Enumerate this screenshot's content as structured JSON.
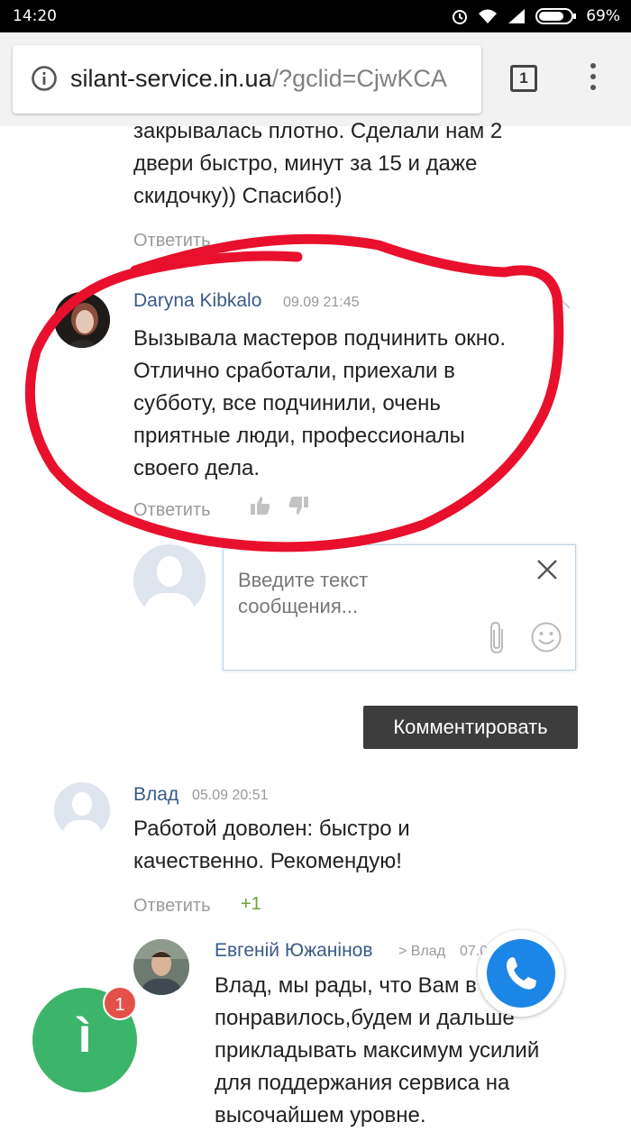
{
  "status": {
    "time": "14:20",
    "battery": "69%"
  },
  "browser": {
    "url_main": "silant-service.in.ua",
    "url_rest": "/?gclid=CjwKCA",
    "tab_count": "1"
  },
  "prev_comment": {
    "lines": [
      "закрывалась плотно. Сделали нам 2",
      "двери быстро, минут за 15 и даже",
      "скидочку)) Спасибо!)"
    ],
    "reply": "Ответить"
  },
  "comment1": {
    "author": "Daryna Kibkalo",
    "date": "09.09 21:45",
    "lines": [
      "Вызывала мастеров подчинить окно.",
      "Отлично сработали, приехали в",
      "субботу, все подчинили, очень",
      "приятные люди, профессионалы",
      "своего дела."
    ],
    "reply": "Ответить"
  },
  "reply_form": {
    "placeholder_line1": "Введите текст",
    "placeholder_line2": "сообщения...",
    "submit": "Комментировать"
  },
  "comment2": {
    "author": "Влад",
    "date": "05.09 20:51",
    "lines": [
      "Работой доволен: быстро и",
      "качественно. Рекомендую!"
    ],
    "reply": "Ответить",
    "votes": "+1"
  },
  "comment3": {
    "author": "Евгеній Южанінов",
    "reply_to": "> Влад",
    "date": "07.09",
    "lines": [
      "Влад, мы рады, что Вам в",
      "понравилось,будем и дальше",
      "прикладывать максимум усилий",
      "для поддержания сервиса на",
      "высочайшем уровне."
    ]
  },
  "chat_widget": {
    "badge": "1",
    "glyph": "ì"
  },
  "colors": {
    "annotation": "#e8102c",
    "author_link": "#3a5a86",
    "chat_green": "#3cb46a",
    "phone_blue": "#1b86e6"
  }
}
